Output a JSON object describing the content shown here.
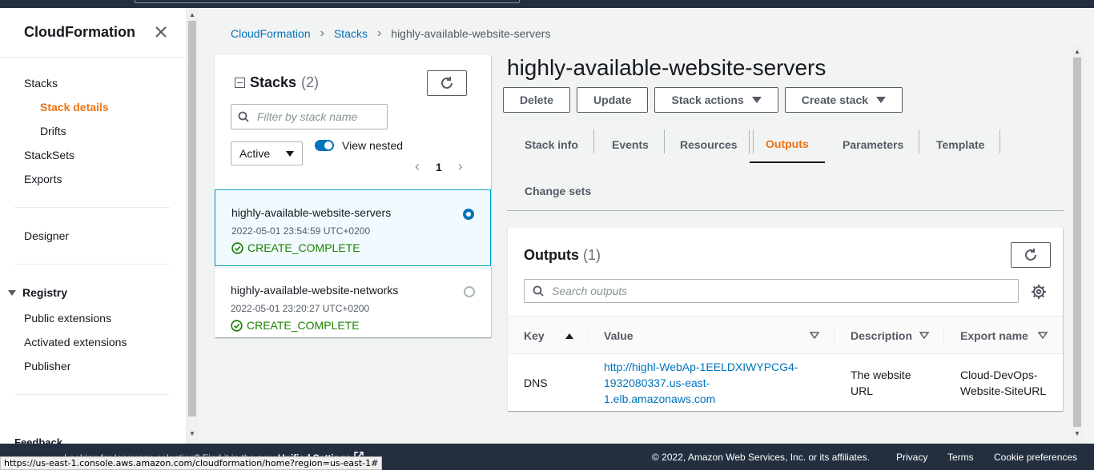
{
  "sidebar": {
    "title": "CloudFormation",
    "items": {
      "stacks": "Stacks",
      "stack_details": "Stack details",
      "drifts": "Drifts",
      "stacksets": "StackSets",
      "exports": "Exports",
      "designer": "Designer",
      "registry": "Registry",
      "public_extensions": "Public extensions",
      "activated_extensions": "Activated extensions",
      "publisher": "Publisher"
    },
    "feedback": "Feedback"
  },
  "breadcrumb": {
    "root": "CloudFormation",
    "stacks": "Stacks",
    "current": "highly-available-website-servers"
  },
  "stacks_panel": {
    "title": "Stacks",
    "count": "(2)",
    "filter_placeholder": "Filter by stack name",
    "status_filter": "Active",
    "view_nested_label": "View nested",
    "page": "1",
    "stacks": [
      {
        "name": "highly-available-website-servers",
        "date": "2022-05-01 23:54:59 UTC+0200",
        "status": "CREATE_COMPLETE",
        "selected": true
      },
      {
        "name": "highly-available-website-networks",
        "date": "2022-05-01 23:20:27 UTC+0200",
        "status": "CREATE_COMPLETE",
        "selected": false
      }
    ]
  },
  "detail": {
    "title": "highly-available-website-servers",
    "buttons": {
      "delete": "Delete",
      "update": "Update",
      "stack_actions": "Stack actions",
      "create_stack": "Create stack"
    },
    "tabs": [
      "Stack info",
      "Events",
      "Resources",
      "Outputs",
      "Parameters",
      "Template",
      "Change sets"
    ],
    "active_tab": "Outputs"
  },
  "outputs": {
    "title": "Outputs",
    "count": "(1)",
    "search_placeholder": "Search outputs",
    "columns": [
      "Key",
      "Value",
      "Description",
      "Export name"
    ],
    "rows": [
      {
        "key": "DNS",
        "value_line1": "http://highl-WebAp-1EELDXIWYPCG4-",
        "value_line2": "1932080337.us-east-",
        "value_line3": "1.elb.amazonaws.com",
        "description_line1": "The website",
        "description_line2": "URL",
        "export_line1": "Cloud-DevOps-",
        "export_line2": "Website-SiteURL"
      }
    ]
  },
  "footer": {
    "language_text": "Looking for language selection? Find it in the new",
    "unified_settings": "Unified Settings",
    "copyright": "© 2022, Amazon Web Services, Inc. or its affiliates.",
    "privacy": "Privacy",
    "terms": "Terms",
    "cookie_preferences": "Cookie preferences"
  },
  "status_bar_url": "https://us-east-1.console.aws.amazon.com/cloudformation/home?region=us-east-1#",
  "colors": {
    "accent_orange": "#ec7211",
    "link_blue": "#0073bb",
    "success_green": "#1d8102",
    "header_dark": "#232f3e"
  }
}
